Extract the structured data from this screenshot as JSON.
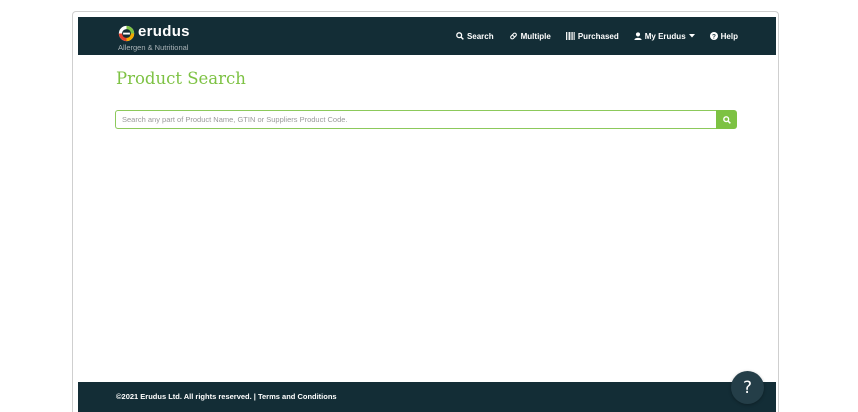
{
  "brand": {
    "name": "erudus",
    "subtitle": "Allergen & Nutritional"
  },
  "nav": {
    "items": [
      {
        "label": "Search",
        "icon": "search-icon"
      },
      {
        "label": "Multiple",
        "icon": "pill-icon"
      },
      {
        "label": "Purchased",
        "icon": "barcode-icon"
      },
      {
        "label": "My Erudus",
        "icon": "user-icon",
        "dropdown": true
      },
      {
        "label": "Help",
        "icon": "question-circle-icon"
      }
    ]
  },
  "page": {
    "title": "Product Search"
  },
  "search": {
    "placeholder": "Search any part of Product Name, GTIN or Suppliers Product Code.",
    "value": ""
  },
  "footer": {
    "copyright": "©2021 Erudus Ltd. All rights reserved. |",
    "terms_link": "Terms and Conditions"
  },
  "help_fab": {
    "label": "?"
  },
  "colors": {
    "navbar_bg": "#132d36",
    "accent_green": "#7dc243",
    "fab_bg": "#243e48"
  }
}
